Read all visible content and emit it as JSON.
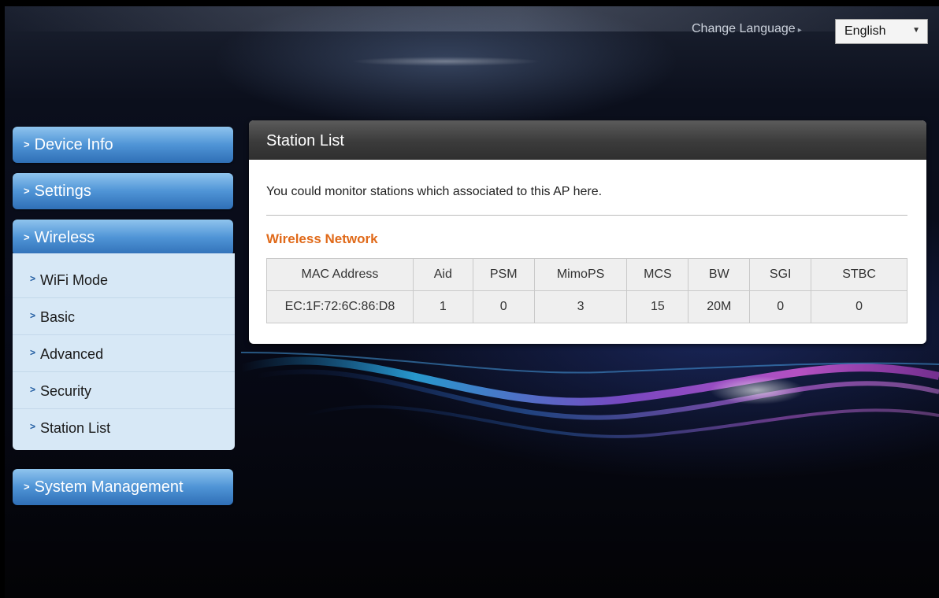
{
  "header": {
    "change_language_label": "Change Language",
    "language_selected": "English"
  },
  "sidebar": {
    "items": [
      {
        "label": "Device Info"
      },
      {
        "label": "Settings"
      },
      {
        "label": "Wireless"
      },
      {
        "label": "System Management"
      }
    ],
    "wireless_submenu": [
      {
        "label": "WiFi Mode"
      },
      {
        "label": "Basic"
      },
      {
        "label": "Advanced"
      },
      {
        "label": "Security"
      },
      {
        "label": "Station List"
      }
    ]
  },
  "main": {
    "title": "Station List",
    "description": "You could monitor stations which associated to this AP here.",
    "section_title": "Wireless Network",
    "table": {
      "columns": [
        "MAC Address",
        "Aid",
        "PSM",
        "MimoPS",
        "MCS",
        "BW",
        "SGI",
        "STBC"
      ],
      "rows": [
        [
          "EC:1F:72:6C:86:D8",
          "1",
          "0",
          "3",
          "15",
          "20M",
          "0",
          "0"
        ]
      ]
    }
  },
  "colors": {
    "nav_button": "#4f94d6",
    "submenu_bg": "#d7e8f6",
    "section_title": "#e06a1a",
    "panel_header": "#3b3b3b"
  },
  "icons": {
    "nav_chevron": "chevron-right-icon",
    "select_caret": "caret-down-icon"
  }
}
